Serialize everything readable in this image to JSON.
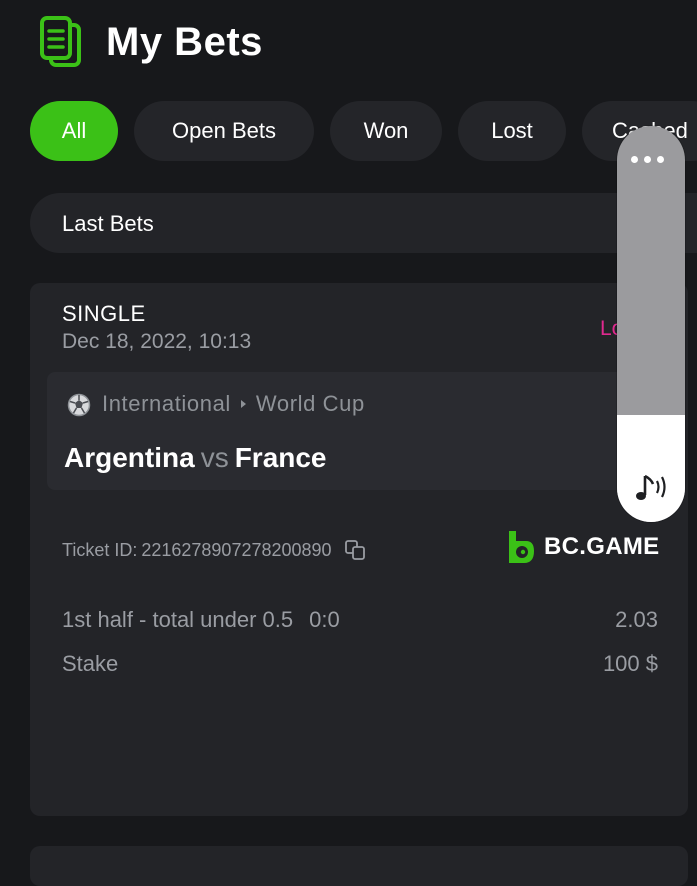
{
  "header": {
    "title": "My Bets",
    "icon": "bets-document-icon"
  },
  "filters": [
    "All",
    "Open Bets",
    "Won",
    "Lost",
    "Cashed"
  ],
  "last_bets": {
    "label": "Last Bets"
  },
  "bet": {
    "type": "SINGLE",
    "date": "Dec 18, 2022, 10:13",
    "status": "Lost",
    "league": {
      "category": "International",
      "competition": "World Cup"
    },
    "home": "Argentina",
    "vs": "vs",
    "away": "France",
    "ticket_label": "Ticket ID:",
    "ticket_id": "221627890727820089",
    "ticket_id_full": "2216278907278200890",
    "brand": "BC.GAME",
    "market": "1st half - total under 0.5",
    "score": "0:0",
    "odds": "2.03",
    "stake_label": "Stake",
    "stake_value": "100 $"
  },
  "volume": {
    "level": 0.27
  },
  "colors": {
    "accent": "#3bc117",
    "lost": "#e0298f",
    "background": "#17181b",
    "card": "#232428"
  }
}
